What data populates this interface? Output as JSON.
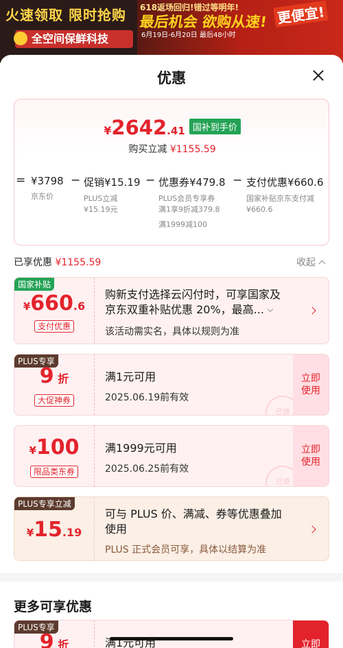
{
  "banner": {
    "left_line1": "火速领取 限时抢购",
    "left_line2": "全空间保鲜科技",
    "mid_line1": "618返场回归!错过等明年!",
    "mid_line2": "最后机会 欲购从速!",
    "mid_line3": "6月19日-6月20日 最后48小时",
    "right_line1": "更便宜!"
  },
  "sheet": {
    "title": "优惠",
    "close_icon": "close-icon"
  },
  "summary": {
    "currency": "¥",
    "price_int": "2642",
    "price_dec": ".41",
    "price_tag": "国补到手价",
    "saving_label": "购买立减",
    "saving_value": "¥1155.59",
    "breakdown": {
      "eq": "=",
      "minus": "−",
      "jd_price": "¥3798",
      "jd_label": "京东价",
      "promo_main": "促销¥15.19",
      "promo_sub1": "PLUS立减",
      "promo_sub2": "¥15.19元",
      "coupon_main": "优惠券¥479.8",
      "coupon_sub1": "PLUS会员专享券",
      "coupon_sub2": "满1享9折减379.8",
      "coupon_sub3": "满1999减100",
      "pay_main": "支付优惠¥660.6",
      "pay_sub1": "国家补贴京东支付减",
      "pay_sub2": "¥660.6"
    }
  },
  "enjoyed": {
    "label": "已享优惠",
    "value": "¥1155.59",
    "collapse_label": "收起"
  },
  "coupons": [
    {
      "tag": "国家补贴",
      "currency": "¥",
      "amount_int": "660",
      "amount_dec": ".6",
      "label": "支付优惠",
      "title_line1": "购新支付选择云闪付时，可享国家及",
      "title_line2": "京东双重补贴优惠 20%，最高...",
      "sub": "该活动需实名，具体以规则为准"
    },
    {
      "tag": "PLUS专享",
      "amount_int": "9",
      "amount_unit": "折",
      "label": "大促神券",
      "title": "满1元可用",
      "sub": "2025.06.19前有效",
      "action": "立即\n使用",
      "stamp": "已领"
    },
    {
      "currency": "¥",
      "amount_int": "100",
      "label": "限品类东券",
      "title": "满1999元可用",
      "sub": "2025.06.25前有效",
      "action": "立即\n使用",
      "stamp": "已领"
    },
    {
      "tag": "PLUS专享立减",
      "currency": "¥",
      "amount_int": "15",
      "amount_dec": ".19",
      "title_line1": "可与 PLUS 价、满减、券等优惠叠加",
      "title_line2": "使用",
      "sub": "PLUS 正式会员可享，具体以结算为准"
    }
  ],
  "more": {
    "title": "更多可享优惠",
    "preview_tag": "PLUS专享",
    "preview_amount": "9",
    "preview_unit": "折",
    "preview_title": "满1元可用",
    "preview_action": "立即"
  },
  "colors": {
    "accent_red": "#e3232c",
    "green_tag": "#24a356",
    "brown_tag": "#5c3b2e"
  }
}
